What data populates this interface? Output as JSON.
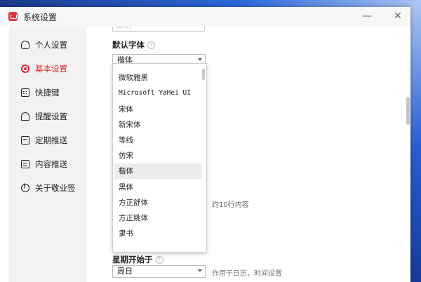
{
  "window": {
    "title": "系统设置",
    "minimize_label": "—",
    "close_label": "✕"
  },
  "sidebar": {
    "items": [
      {
        "label": "个人设置",
        "icon": "user-icon"
      },
      {
        "label": "基本设置",
        "icon": "target-icon",
        "active": true
      },
      {
        "label": "快捷键",
        "icon": "keyboard-icon"
      },
      {
        "label": "提醒设置",
        "icon": "bell-icon"
      },
      {
        "label": "定期推送",
        "icon": "calendar-icon"
      },
      {
        "label": "内容推送",
        "icon": "document-icon"
      },
      {
        "label": "关于敬业签",
        "icon": "info-icon"
      }
    ]
  },
  "main": {
    "previous_select_value": "默认",
    "default_font": {
      "label": "默认字体",
      "help": "?",
      "value": "楷体"
    },
    "rows_hint": "约10行内容",
    "week_start": {
      "label": "星期开始于",
      "help": "?",
      "value": "周日",
      "hint": "作用于日历，时间设置"
    }
  },
  "font_dropdown": {
    "options": [
      "微软雅黑",
      "Microsoft YaHei UI",
      "宋体",
      "新宋体",
      "等线",
      "仿宋",
      "楷体",
      "黑体",
      "方正舒体",
      "方正姚体",
      "隶书"
    ],
    "hovered": "楷体"
  },
  "colors": {
    "accent": "#e0282d",
    "sidebar_bg": "#f2f2f2",
    "window_bg": "#ffffff"
  }
}
